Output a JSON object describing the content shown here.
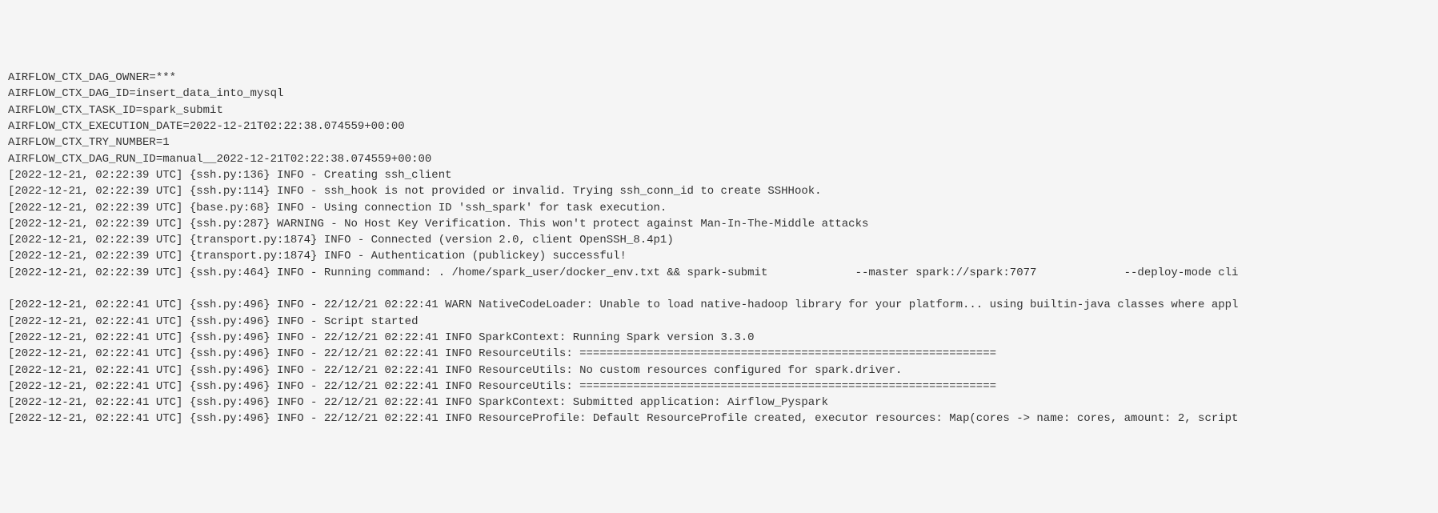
{
  "log": {
    "lines": [
      "AIRFLOW_CTX_DAG_OWNER=***",
      "AIRFLOW_CTX_DAG_ID=insert_data_into_mysql",
      "AIRFLOW_CTX_TASK_ID=spark_submit",
      "AIRFLOW_CTX_EXECUTION_DATE=2022-12-21T02:22:38.074559+00:00",
      "AIRFLOW_CTX_TRY_NUMBER=1",
      "AIRFLOW_CTX_DAG_RUN_ID=manual__2022-12-21T02:22:38.074559+00:00",
      "[2022-12-21, 02:22:39 UTC] {ssh.py:136} INFO - Creating ssh_client",
      "[2022-12-21, 02:22:39 UTC] {ssh.py:114} INFO - ssh_hook is not provided or invalid. Trying ssh_conn_id to create SSHHook.",
      "[2022-12-21, 02:22:39 UTC] {base.py:68} INFO - Using connection ID 'ssh_spark' for task execution.",
      "[2022-12-21, 02:22:39 UTC] {ssh.py:287} WARNING - No Host Key Verification. This won't protect against Man-In-The-Middle attacks",
      "[2022-12-21, 02:22:39 UTC] {transport.py:1874} INFO - Connected (version 2.0, client OpenSSH_8.4p1)",
      "[2022-12-21, 02:22:39 UTC] {transport.py:1874} INFO - Authentication (publickey) successful!",
      "[2022-12-21, 02:22:39 UTC] {ssh.py:464} INFO - Running command: . /home/spark_user/docker_env.txt && spark-submit             --master spark://spark:7077             --deploy-mode cli",
      "",
      "[2022-12-21, 02:22:41 UTC] {ssh.py:496} INFO - 22/12/21 02:22:41 WARN NativeCodeLoader: Unable to load native-hadoop library for your platform... using builtin-java classes where appl",
      "[2022-12-21, 02:22:41 UTC] {ssh.py:496} INFO - Script started",
      "[2022-12-21, 02:22:41 UTC] {ssh.py:496} INFO - 22/12/21 02:22:41 INFO SparkContext: Running Spark version 3.3.0",
      "[2022-12-21, 02:22:41 UTC] {ssh.py:496} INFO - 22/12/21 02:22:41 INFO ResourceUtils: ==============================================================",
      "[2022-12-21, 02:22:41 UTC] {ssh.py:496} INFO - 22/12/21 02:22:41 INFO ResourceUtils: No custom resources configured for spark.driver.",
      "[2022-12-21, 02:22:41 UTC] {ssh.py:496} INFO - 22/12/21 02:22:41 INFO ResourceUtils: ==============================================================",
      "[2022-12-21, 02:22:41 UTC] {ssh.py:496} INFO - 22/12/21 02:22:41 INFO SparkContext: Submitted application: Airflow_Pyspark",
      "[2022-12-21, 02:22:41 UTC] {ssh.py:496} INFO - 22/12/21 02:22:41 INFO ResourceProfile: Default ResourceProfile created, executor resources: Map(cores -> name: cores, amount: 2, script"
    ]
  }
}
